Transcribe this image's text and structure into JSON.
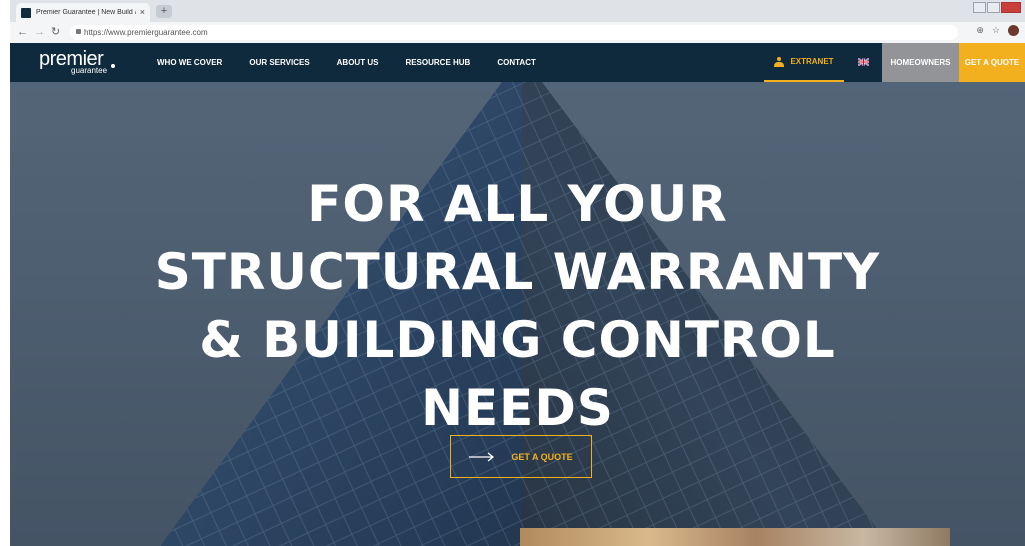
{
  "browser": {
    "tab_title": "Premier Guarantee | New Build & ...",
    "tab_close": "×",
    "new_tab": "+",
    "url": "https://www.premierguarantee.com",
    "back_icon": "arrow-left-icon",
    "forward_icon": "arrow-right-icon",
    "reload_icon": "reload-icon"
  },
  "header": {
    "logo_main": "premier",
    "logo_sub": "guarantee",
    "nav": [
      "WHO WE COVER",
      "OUR SERVICES",
      "ABOUT US",
      "RESOURCE HUB",
      "CONTACT"
    ],
    "extranet": "EXTRANET",
    "homeowners": "HOMEOWNERS",
    "get_quote": "GET A QUOTE"
  },
  "hero": {
    "lines": [
      "FOR ALL YOUR",
      "STRUCTURAL WARRANTY",
      "& BUILDING CONTROL",
      "NEEDS"
    ],
    "cta": "GET A QUOTE"
  },
  "colors": {
    "navy": "#0f2a3d",
    "accent": "#f2b01e",
    "grey": "#929497"
  }
}
